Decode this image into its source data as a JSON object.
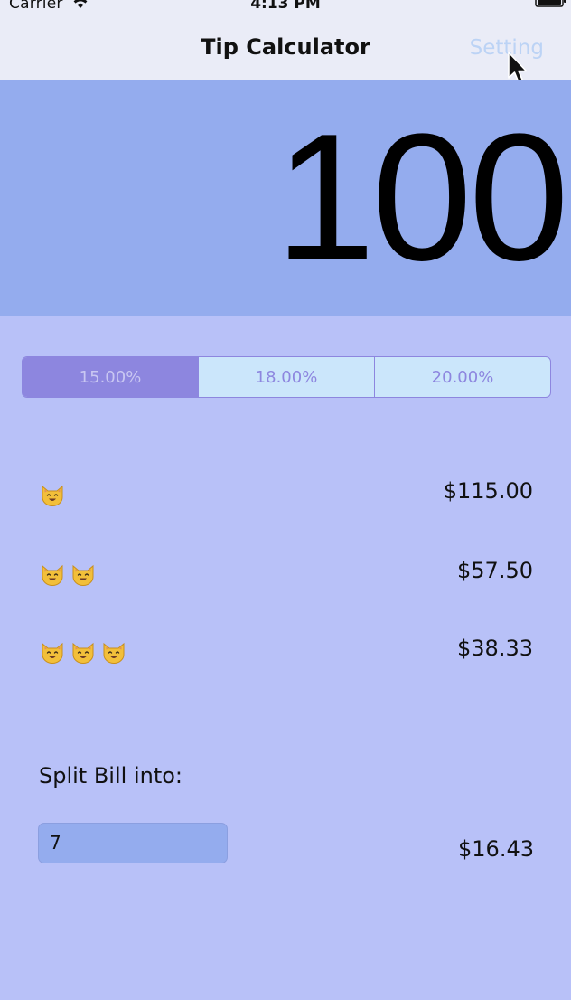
{
  "status_bar": {
    "carrier": "Carrier",
    "time": "4:13 PM"
  },
  "nav": {
    "title": "Tip Calculator",
    "setting_label": "Setting"
  },
  "bill": {
    "amount": "100"
  },
  "tip_options": {
    "options": [
      "15.00%",
      "18.00%",
      "20.00%"
    ],
    "selected_index": 0
  },
  "results": [
    {
      "cat_count": 1,
      "value": "$115.00"
    },
    {
      "cat_count": 2,
      "value": "$57.50"
    },
    {
      "cat_count": 3,
      "value": "$38.33"
    }
  ],
  "split": {
    "label": "Split Bill into:",
    "input_value": "7",
    "value": "$16.43"
  },
  "colors": {
    "background": "#b8c1f8",
    "bill_area": "#94acee",
    "segment_selected": "#8d86df",
    "segment_unselected": "#cbe6fb",
    "setting_link": "#bcd3f5"
  },
  "icons": {
    "cat": "cat-face-icon",
    "wifi": "wifi-icon",
    "battery": "battery-icon",
    "cursor": "mouse-pointer-icon"
  }
}
